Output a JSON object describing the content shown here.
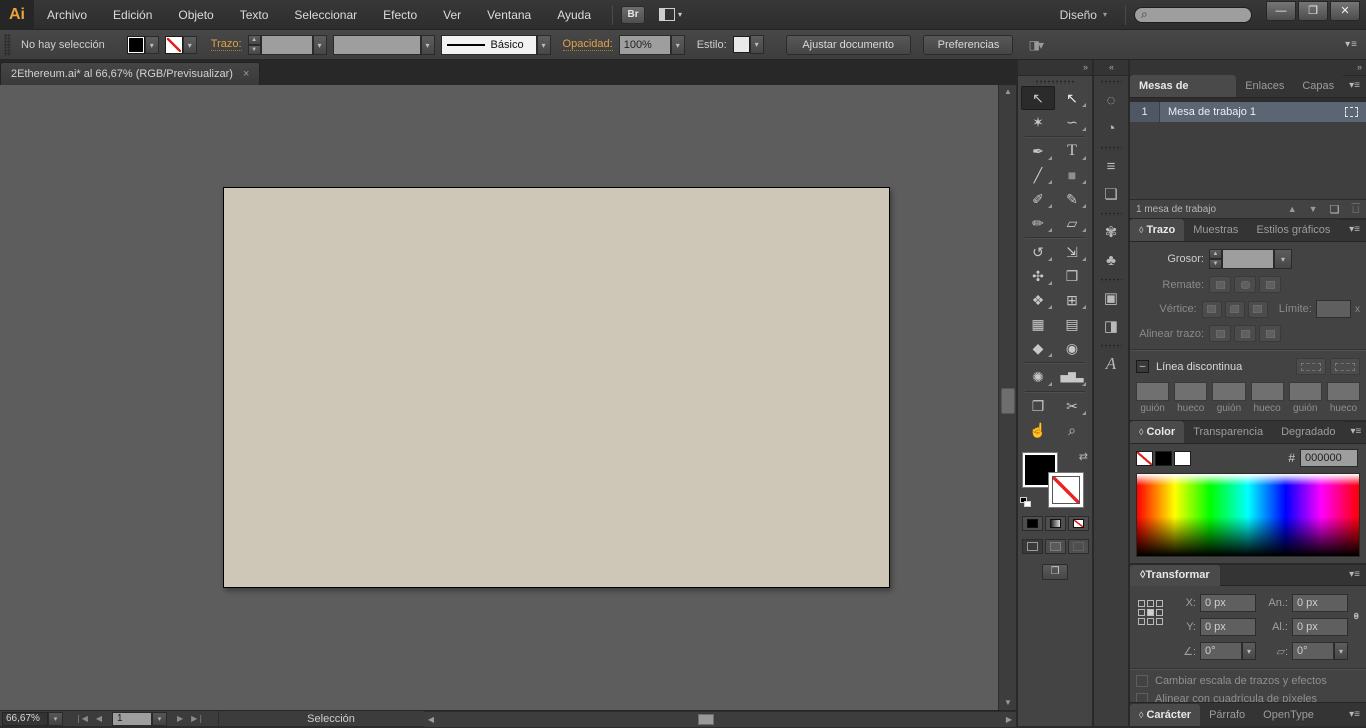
{
  "icons": {
    "collapse_diamond": "◊",
    "panel_menu": "▾≡",
    "dropdown": "▾",
    "step_up": "▲",
    "step_down": "▼",
    "expand_right": "»",
    "expand_left": "«",
    "swap": "⇄",
    "search": "⌕",
    "minimize": "—",
    "restore": "❐",
    "close": "✕",
    "nav_first": "❘◀",
    "nav_prev": "◀",
    "nav_next": "▶",
    "nav_last": "▶❘",
    "scroll_up": "▲",
    "scroll_down": "▼",
    "scroll_left": "◀",
    "scroll_right": "▶",
    "arrow_up": "▲",
    "arrow_down": "▼",
    "new_item": "❏",
    "trash": "⊔",
    "link": "⚭",
    "select_similar": "◨▾"
  },
  "menu": {
    "logo": "Ai",
    "items": [
      "Archivo",
      "Edición",
      "Objeto",
      "Texto",
      "Seleccionar",
      "Efecto",
      "Ver",
      "Ventana",
      "Ayuda"
    ],
    "bridge_label": "Br",
    "workspace": "Diseño"
  },
  "control": {
    "selection_status": "No hay selección",
    "stroke_label": "Trazo:",
    "stroke_style": "Básico",
    "opacity_label": "Opacidad:",
    "opacity_value": "100%",
    "style_label": "Estilo:",
    "fit_document_button": "Ajustar documento",
    "preferences_button": "Preferencias"
  },
  "document_tab": {
    "title": "2Ethereum.ai* al 66,67% (RGB/Previsualizar)",
    "close": "×"
  },
  "tools": {
    "selection": "↖",
    "direct_selection": "↖",
    "magic_wand": "✶",
    "lasso": "∽",
    "pen": "✒",
    "type": "T",
    "line": "╱",
    "rectangle": "■",
    "paintbrush": "✐",
    "pencil": "✎",
    "blob_brush": "✏",
    "eraser": "▱",
    "rotate": "↺",
    "scale": "⇲",
    "width": "✣",
    "free_transform": "❒",
    "shape_builder": "❖",
    "perspective_grid": "⊞",
    "mesh": "▦",
    "gradient": "▤",
    "eyedropper": "◆",
    "blend": "◉",
    "symbol_sprayer": "✺",
    "column_graph": "▅▇▃",
    "artboard": "❐",
    "slice": "✂",
    "hand": "☝",
    "zoom": "⌕"
  },
  "collapsed_icons": {
    "dashed_circle": "◌",
    "color_guide": "◔",
    "align": "≡",
    "pathfinder": "❏",
    "brushes": "✾",
    "symbols": "♣",
    "graphic_styles": "▣",
    "appearance": "◨",
    "character_styles": "A"
  },
  "artboards_panel": {
    "tabs": [
      "Mesas de trabajo",
      "Enlaces",
      "Capas"
    ],
    "row_number": "1",
    "row_name": "Mesa de trabajo 1",
    "footer": "1 mesa de trabajo"
  },
  "stroke_panel": {
    "tabs": [
      "Trazo",
      "Muestras",
      "Estilos gráficos"
    ],
    "weight_label": "Grosor:",
    "cap_label": "Remate:",
    "corner_label": "Vértice:",
    "limit_label": "Límite:",
    "limit_suffix": "x",
    "align_label": "Alinear trazo:",
    "dashed_label": "Línea discontinua",
    "dash_fields": [
      "guión",
      "hueco",
      "guión",
      "hueco",
      "guión",
      "hueco"
    ]
  },
  "color_panel": {
    "tabs": [
      "Color",
      "Transparencia",
      "Degradado"
    ],
    "hex_label": "#",
    "hex_value": "000000"
  },
  "transform_panel": {
    "title": "Transformar",
    "x_label": "X:",
    "y_label": "Y:",
    "width_label": "An.:",
    "height_label": "Al.:",
    "x_value": "0 px",
    "y_value": "0 px",
    "width_value": "0 px",
    "height_value": "0 px",
    "angle_label": "∠:",
    "shear_label": "▱:",
    "rotate_value": "0°",
    "shear_value": "0°",
    "scale_strokes_checkbox": "Cambiar escala de trazos y efectos",
    "pixel_grid_checkbox": "Alinear con cuadrícula de píxeles"
  },
  "type_tabs": {
    "character": "Carácter",
    "paragraph": "Párrafo",
    "opentype": "OpenType"
  },
  "status_bar": {
    "zoom": "66,67%",
    "artboard_number": "1",
    "status": "Selección"
  },
  "colors": {
    "artboard": "#cec7b8",
    "accent_orange": "#e2a14a",
    "selected_row": "#5c6573"
  }
}
